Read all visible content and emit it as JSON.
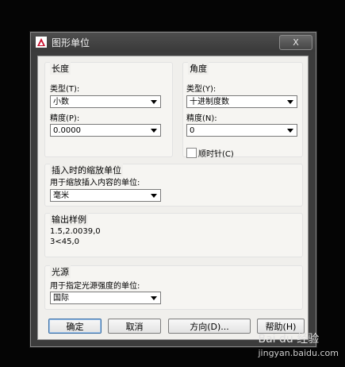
{
  "window": {
    "title": "图形单位",
    "close_label": "X"
  },
  "length": {
    "group_title": "长度",
    "type_label": "类型(T):",
    "type_value": "小数",
    "precision_label": "精度(P):",
    "precision_value": "0.0000"
  },
  "angle": {
    "group_title": "角度",
    "type_label": "类型(Y):",
    "type_value": "十进制度数",
    "precision_label": "精度(N):",
    "precision_value": "0",
    "clockwise_label": "顺时针(C)",
    "clockwise_checked": false
  },
  "insertion_scale": {
    "group_title": "插入时的缩放单位",
    "units_label": "用于缩放插入内容的单位:",
    "units_value": "毫米"
  },
  "sample_output": {
    "group_title": "输出样例",
    "line1": "1.5,2.0039,0",
    "line2": "3<45,0"
  },
  "lighting": {
    "group_title": "光源",
    "units_label": "用于指定光源强度的单位:",
    "units_value": "国际"
  },
  "buttons": {
    "ok": "确定",
    "cancel": "取消",
    "direction": "方向(D)...",
    "help": "帮助(H)"
  },
  "watermark": {
    "brand": "Bai du 经验",
    "url": "jingyan.baidu.com"
  },
  "colors": {
    "accent": "#3a6ea5",
    "autocad_red": "#c8102e"
  }
}
